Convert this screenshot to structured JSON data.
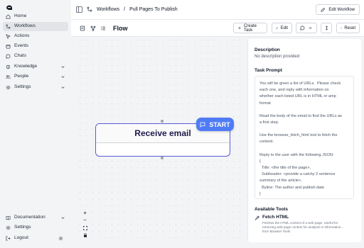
{
  "sidebar": {
    "items": [
      {
        "label": "Home",
        "icon": "home-icon"
      },
      {
        "label": "Workflows",
        "icon": "workflow-icon",
        "active": true
      },
      {
        "label": "Actions",
        "icon": "actions-icon"
      },
      {
        "label": "Events",
        "icon": "calendar-icon"
      },
      {
        "label": "Chats",
        "icon": "chat-icon"
      },
      {
        "label": "Knowledge",
        "icon": "brain-icon",
        "has_chevron": true
      },
      {
        "label": "People",
        "icon": "people-icon",
        "has_chevron": true
      },
      {
        "label": "Settings",
        "icon": "gear-icon",
        "has_chevron": true
      }
    ],
    "bottom": [
      {
        "label": "Documentation",
        "icon": "book-icon",
        "has_chevron": true
      },
      {
        "label": "Settings",
        "icon": "gear-icon"
      },
      {
        "label": "Logout",
        "icon": "logout-icon"
      }
    ]
  },
  "header": {
    "breadcrumb_root": "Workflows",
    "breadcrumb_current": "Pull Pages To Publish",
    "edit_workflow_label": "Edit Workflow"
  },
  "toolbar": {
    "title": "Flow",
    "create_task_label": "Create Task",
    "edit_label": "Edit",
    "reset_label": "Reset"
  },
  "canvas": {
    "node_title": "Receive email",
    "start_label": "START",
    "zoom_in": "+",
    "zoom_out": "−"
  },
  "panel": {
    "description_heading": "Description",
    "description_value": "No description provided",
    "task_prompt_heading": "Task Prompt",
    "task_prompt_lines": [
      "You will be given a list of URLs.  Please check",
      "each one, and reply with information on",
      "whether each listed URL is in HTML or amp",
      "format",
      "",
      "Read the body of the email to find the URLs as",
      "a first step.",
      "",
      "Use the browser_fetch_html tool to fetch the",
      "content.",
      "",
      "Reply to the user with the following JSON:",
      "{",
      "  Title: <the title of the page>,",
      "  Subheader: <provide a catchy 2 sentence",
      "summary of the article>,",
      "  Byline: The author and publish date",
      "}"
    ],
    "tools_heading": "Available Tools",
    "tool_name": "Fetch HTML",
    "tool_desc_1": "Fetches the HTML content of a web page. Useful for",
    "tool_desc_2": "retrieving web page content for analysis or information...",
    "tool_source": "from Browser Tools"
  },
  "colors": {
    "accent": "#4f7cf6",
    "node_border": "#5b5bd6",
    "sidebar_bg": "#f3f4f6"
  }
}
